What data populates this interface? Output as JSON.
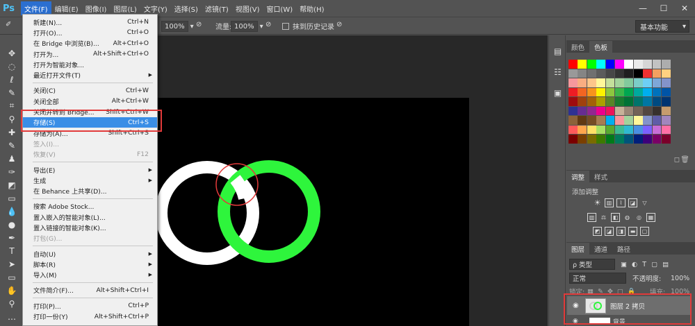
{
  "app": {
    "logo": "Ps",
    "menus": [
      "文件(F)",
      "编辑(E)",
      "图像(I)",
      "图层(L)",
      "文字(Y)",
      "选择(S)",
      "滤镜(T)",
      "视图(V)",
      "窗口(W)",
      "帮助(H)"
    ],
    "window_controls": [
      "—",
      "☐",
      "✕"
    ]
  },
  "options_bar": {
    "opacity_value": "100%",
    "flow_label": "流量:",
    "flow_value": "100%",
    "history_label": "抹到历史记录",
    "workspace": "基本功能"
  },
  "file_menu": {
    "items": [
      {
        "label": "新建(N)...",
        "shortcut": "Ctrl+N"
      },
      {
        "label": "打开(O)...",
        "shortcut": "Ctrl+O"
      },
      {
        "label": "在 Bridge 中浏览(B)...",
        "shortcut": "Alt+Ctrl+O"
      },
      {
        "label": "打开为...",
        "shortcut": "Alt+Shift+Ctrl+O"
      },
      {
        "label": "打开为智能对象...",
        "shortcut": ""
      },
      {
        "label": "最近打开文件(T)",
        "shortcut": "",
        "submenu": true
      },
      {
        "separator": true
      },
      {
        "label": "关闭(C)",
        "shortcut": "Ctrl+W"
      },
      {
        "label": "关闭全部",
        "shortcut": "Alt+Ctrl+W"
      },
      {
        "label": "关闭并转到 Bridge...",
        "shortcut": "Shift+Ctrl+W"
      },
      {
        "label": "存储(S)",
        "shortcut": "Ctrl+S",
        "highlight": true
      },
      {
        "label": "存储为(A)...",
        "shortcut": "Shift+Ctrl+S"
      },
      {
        "label": "签入(I)...",
        "shortcut": "",
        "disabled": true
      },
      {
        "label": "恢复(V)",
        "shortcut": "F12",
        "disabled": true
      },
      {
        "separator": true
      },
      {
        "label": "导出(E)",
        "shortcut": "",
        "submenu": true
      },
      {
        "label": "生成",
        "shortcut": "",
        "submenu": true
      },
      {
        "label": "在 Behance 上共享(D)...",
        "shortcut": ""
      },
      {
        "separator": true
      },
      {
        "label": "搜索 Adobe Stock...",
        "shortcut": ""
      },
      {
        "label": "置入嵌入的智能对象(L)...",
        "shortcut": ""
      },
      {
        "label": "置入链接的智能对象(K)...",
        "shortcut": ""
      },
      {
        "label": "打包(G)...",
        "shortcut": "",
        "disabled": true
      },
      {
        "separator": true
      },
      {
        "label": "自动(U)",
        "shortcut": "",
        "submenu": true
      },
      {
        "label": "脚本(R)",
        "shortcut": "",
        "submenu": true
      },
      {
        "label": "导入(M)",
        "shortcut": "",
        "submenu": true
      },
      {
        "separator": true
      },
      {
        "label": "文件简介(F)...",
        "shortcut": "Alt+Shift+Ctrl+I"
      },
      {
        "separator": true
      },
      {
        "label": "打印(P)...",
        "shortcut": "Ctrl+P"
      },
      {
        "label": "打印一份(Y)",
        "shortcut": "Alt+Shift+Ctrl+P"
      }
    ]
  },
  "panels": {
    "color_tabs": [
      "颜色",
      "色板"
    ],
    "adjust_tabs": [
      "调整",
      "样式"
    ],
    "adjust_add_label": "添加调整",
    "layers_tabs": [
      "图层",
      "通道",
      "路径"
    ],
    "layer_filter": "ρ 类型",
    "blend_mode": "正常",
    "opacity_label": "不透明度:",
    "opacity_value": "100%",
    "lock_label": "锁定:",
    "fill_label": "填充:",
    "fill_value": "100%",
    "layer_name": "图层 2 拷贝",
    "bottom_layer_label": "背景"
  },
  "colors": {
    "accent": "#2b6fd0",
    "highlight": "#3a8ee6",
    "green_ring": "#2ef53c",
    "white_ring": "#ffffff",
    "annotation_red": "#e23a3a"
  },
  "swatches": [
    [
      "#ff0000",
      "#ffff00",
      "#00ff00",
      "#00ffff",
      "#0000ff",
      "#ff00ff",
      "#ffffff",
      "#ebebeb",
      "#d6d6d6",
      "#c2c2c2",
      "#adadad"
    ],
    [
      "#999999",
      "#858585",
      "#707070",
      "#5c5c5c",
      "#474747",
      "#333333",
      "#1f1f1f",
      "#000000",
      "#ee3030",
      "#f4a060",
      "#ffd080"
    ],
    [
      "#f6989d",
      "#f9ad81",
      "#fdc68a",
      "#fff79a",
      "#c4df9b",
      "#a3d39c",
      "#82ca9d",
      "#7bcdc8",
      "#6ecff6",
      "#7ea7d8",
      "#8493ca"
    ],
    [
      "#ed1c24",
      "#f26522",
      "#f7941d",
      "#fff200",
      "#8dc63f",
      "#39b54a",
      "#00a651",
      "#00a99d",
      "#00aeef",
      "#0072bc",
      "#0054a6"
    ],
    [
      "#9e0b0f",
      "#a0410d",
      "#a36209",
      "#aba000",
      "#598527",
      "#197b30",
      "#007236",
      "#00746b",
      "#0076a3",
      "#004a80",
      "#003471"
    ],
    [
      "#2e3192",
      "#662d91",
      "#92278f",
      "#ec008c",
      "#ed145b",
      "#c7b299",
      "#998675",
      "#736357",
      "#534741",
      "#37302d",
      "#c69c6d"
    ],
    [
      "#8c6239",
      "#603913",
      "#754c24",
      "#a67c52",
      "#00aeef",
      "#f6989d",
      "#a3d39c",
      "#fff79a",
      "#8493ca",
      "#605ca8",
      "#a186be"
    ],
    [
      "#ff5a5a",
      "#ffa64d",
      "#ffe066",
      "#a8e063",
      "#56ab2f",
      "#3cba92",
      "#30b9d1",
      "#4a90e2",
      "#7b61ff",
      "#c86dd7",
      "#ff6fa5"
    ],
    [
      "#7a0000",
      "#7a3f00",
      "#7a6b00",
      "#3d7a00",
      "#007a1a",
      "#007a5c",
      "#00547a",
      "#001f7a",
      "#3d007a",
      "#7a0066",
      "#7a002a"
    ]
  ]
}
